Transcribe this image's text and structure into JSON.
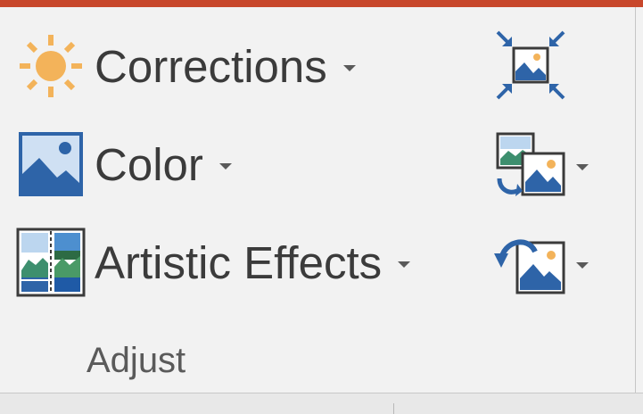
{
  "ribbon_group": {
    "label": "Adjust",
    "commands": {
      "corrections": {
        "label": "Corrections",
        "icon": "sun-icon"
      },
      "color": {
        "label": "Color",
        "icon": "picture-color-icon"
      },
      "artistic_effects": {
        "label": "Artistic Effects",
        "icon": "artistic-effects-icon"
      }
    },
    "small_commands": {
      "compress_pictures": {
        "icon": "compress-pictures-icon"
      },
      "change_picture": {
        "icon": "change-picture-icon"
      },
      "reset_picture": {
        "icon": "reset-picture-icon"
      }
    }
  },
  "colors": {
    "accent_top_bar": "#c8472b",
    "icon_blue": "#2e64a8",
    "sun_orange": "#f3b35a",
    "text": "#3b3b3b"
  }
}
